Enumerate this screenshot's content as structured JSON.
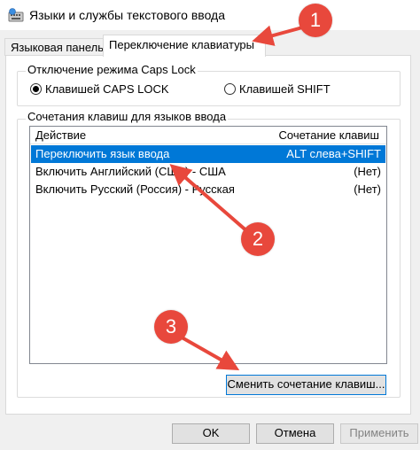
{
  "window": {
    "title": "Языки и службы текстового ввода",
    "icon": "keyboard-language-icon"
  },
  "tabs": [
    {
      "label": "Языковая панель",
      "active": false
    },
    {
      "label": "Переключение клавиатуры",
      "active": true
    }
  ],
  "caps_lock": {
    "legend": "Отключение режима Caps Lock",
    "options": [
      {
        "label": "Клавишей CAPS LOCK",
        "checked": true
      },
      {
        "label": "Клавишей SHIFT",
        "checked": false
      }
    ]
  },
  "hotkeys": {
    "legend": "Сочетания клавиш для языков ввода",
    "columns": [
      "Действие",
      "Сочетание клавиш"
    ],
    "rows": [
      {
        "action": "Переключить язык ввода",
        "combo": "ALT слева+SHIFT",
        "selected": true
      },
      {
        "action": "Включить Английский (США) - США",
        "combo": "(Нет)",
        "selected": false
      },
      {
        "action": "Включить Русский (Россия) - Русская",
        "combo": "(Нет)",
        "selected": false
      }
    ],
    "change_button": "Сменить сочетание клавиш..."
  },
  "buttons": {
    "ok": "OK",
    "cancel": "Отмена",
    "apply": "Применить"
  },
  "annotations": {
    "markers": [
      "1",
      "2",
      "3"
    ],
    "color": "#e8483c"
  },
  "colors": {
    "selection": "#0078d7",
    "accent_border": "#0078d7"
  }
}
